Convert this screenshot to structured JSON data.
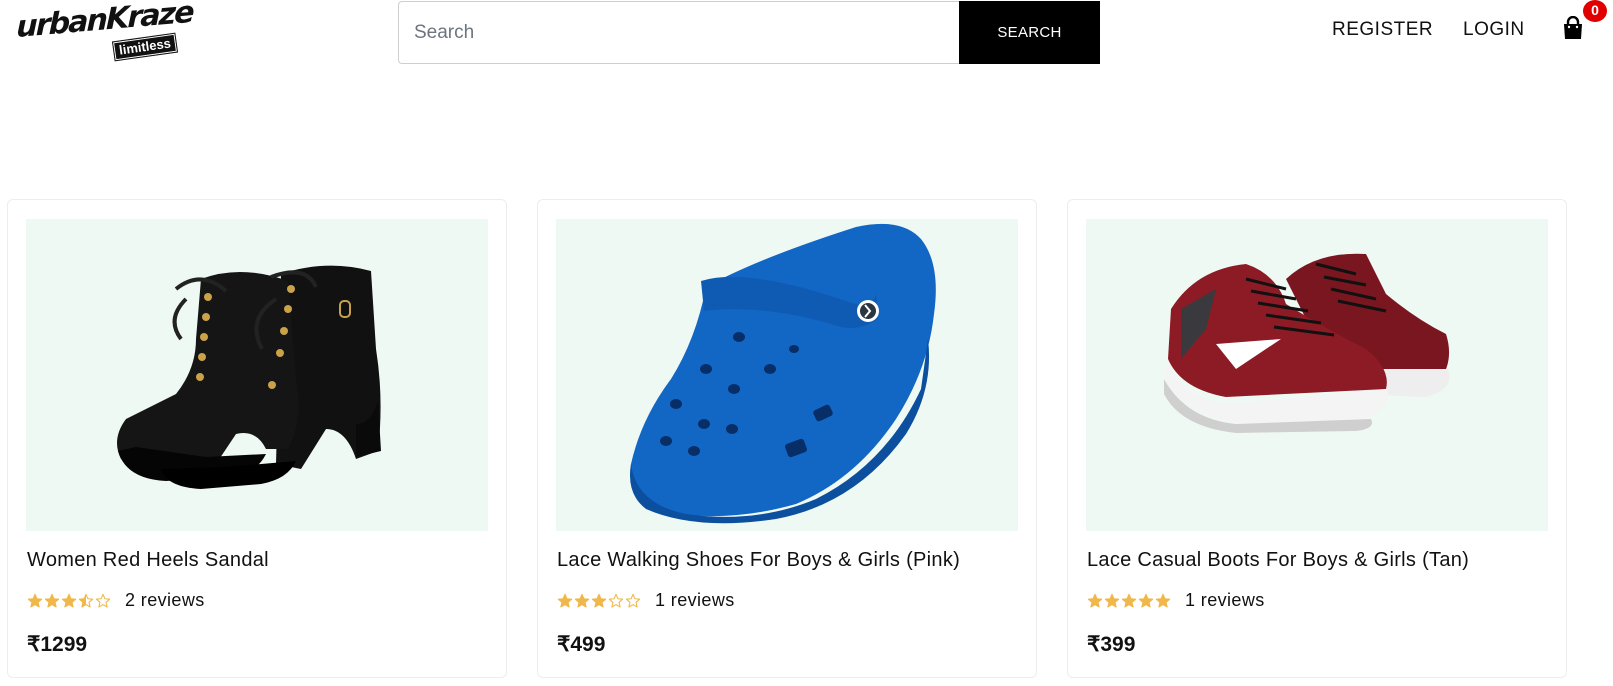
{
  "header": {
    "logo_main": "urbanKraze",
    "logo_sub": "limitless",
    "search_placeholder": "Search",
    "search_button": "SEARCH",
    "nav": {
      "register": "REGISTER",
      "login": "LOGIN"
    },
    "cart_icon": "shopping-bag-icon",
    "cart_count": "0"
  },
  "colors": {
    "accent_black": "#000000",
    "image_bg": "#eff9f4",
    "star": "#f0b74a",
    "badge": "#e00000"
  },
  "products": [
    {
      "title": "Women Red Heels Sandal",
      "rating": 3.5,
      "reviews": "2 reviews",
      "price": "₹1299",
      "image": "black-heeled-boot"
    },
    {
      "title": "Lace Walking Shoes For Boys & Girls (Pink)",
      "rating": 3,
      "reviews": "1 reviews",
      "price": "₹499",
      "image": "blue-clog"
    },
    {
      "title": "Lace Casual Boots For Boys & Girls (Tan)",
      "rating": 5,
      "reviews": "1 reviews",
      "price": "₹399",
      "image": "red-sneakers"
    }
  ]
}
